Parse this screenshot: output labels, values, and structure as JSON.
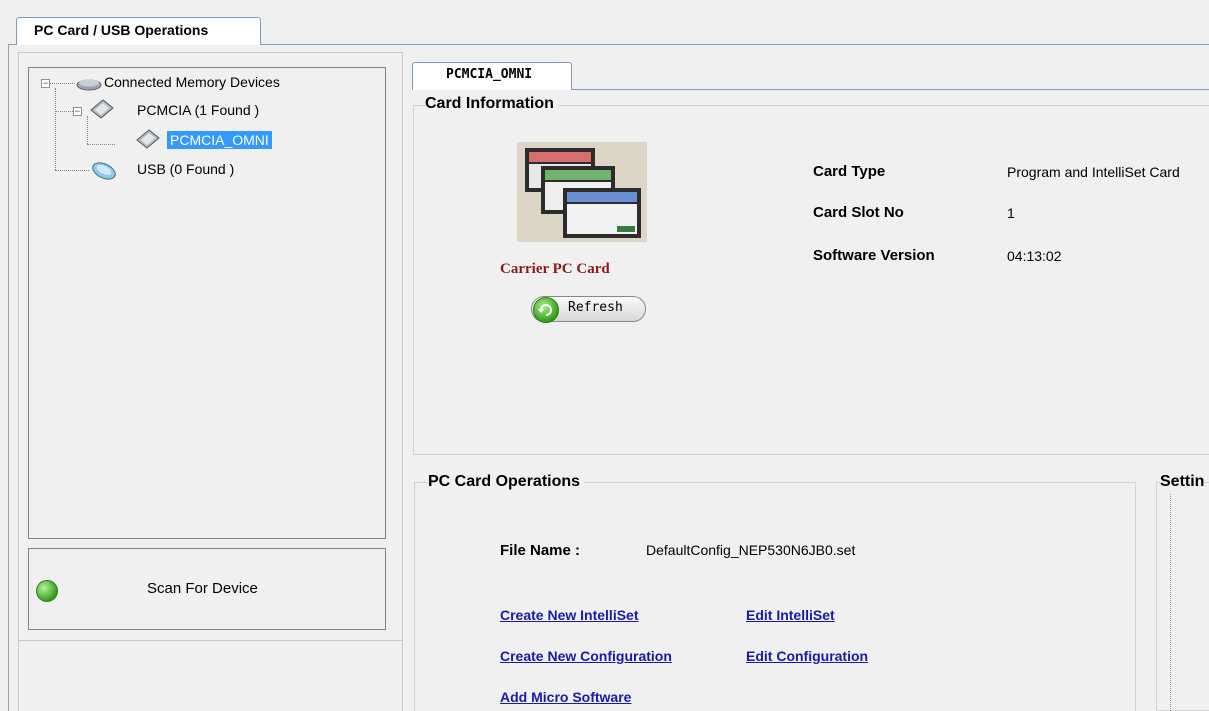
{
  "main_tab": {
    "label": "PC Card / USB Operations"
  },
  "tree": {
    "root_label": "Connected Memory Devices",
    "pcmcia_label": "PCMCIA (1 Found )",
    "pcmcia_child_label": "PCMCIA_OMNI",
    "usb_label": "USB (0 Found )",
    "expander_symbol": "−"
  },
  "scan": {
    "label": "Scan For Device"
  },
  "device_tab": {
    "label": "PCMCIA_OMNI"
  },
  "card_info": {
    "title": "Card Information",
    "image_caption": "Carrier PC Card",
    "refresh_label": "Refresh",
    "fields": [
      {
        "key": "Card Type",
        "value": "Program and IntelliSet Card"
      },
      {
        "key": "Card Slot No",
        "value": "1"
      },
      {
        "key": "Software Version",
        "value": "04:13:02"
      }
    ]
  },
  "pc_card_ops": {
    "title": "PC Card Operations",
    "file_name_key": "File Name :",
    "file_name_value": "DefaultConfig_NEP530N6JB0.set",
    "links": {
      "create_intelliset": "Create New IntelliSet",
      "edit_intelliset": "Edit IntelliSet",
      "create_configuration": "Create New Configuration",
      "edit_configuration": "Edit Configuration",
      "add_micro_software": "Add Micro Software"
    }
  },
  "settings": {
    "title": "Settin"
  },
  "colors": {
    "selection": "#3399ff",
    "link": "#1a1aa6",
    "caption": "#8b1a1a",
    "tab_border": "#7f9db9"
  }
}
